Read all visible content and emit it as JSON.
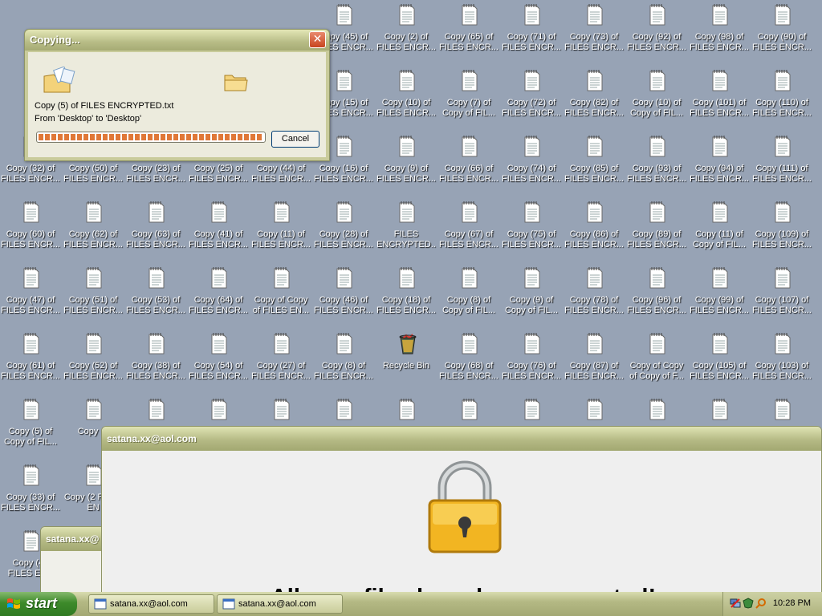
{
  "desktop": {
    "icons": [
      {
        "label": "Copy (45) of FILES ENCR...",
        "type": "text"
      },
      {
        "label": "Copy (2) of FILES ENCR...",
        "type": "text"
      },
      {
        "label": "Copy (65) of FILES ENCR...",
        "type": "text"
      },
      {
        "label": "Copy (71) of FILES ENCR...",
        "type": "text"
      },
      {
        "label": "Copy (73) of FILES ENCR...",
        "type": "text"
      },
      {
        "label": "Copy (92) of FILES ENCR...",
        "type": "text"
      },
      {
        "label": "Copy (98) of FILES ENCR...",
        "type": "text"
      },
      {
        "label": "Copy (90) of FILES ENCR...",
        "type": "text"
      },
      {
        "label": "Copy (15) of FILES ENCR...",
        "type": "text"
      },
      {
        "label": "Copy (10) of FILES ENCR...",
        "type": "text"
      },
      {
        "label": "Copy (7) of Copy of FIL...",
        "type": "text"
      },
      {
        "label": "Copy (72) of FILES ENCR...",
        "type": "text"
      },
      {
        "label": "Copy (82) of FILES ENCR...",
        "type": "text"
      },
      {
        "label": "Copy (10) of Copy of FIL...",
        "type": "text"
      },
      {
        "label": "Copy (101) of FILES ENCR...",
        "type": "text"
      },
      {
        "label": "Copy (110) of FILES ENCR...",
        "type": "text"
      },
      {
        "label": "Copy (32) of FILES ENCR...",
        "type": "text"
      },
      {
        "label": "Copy (50) of FILES ENCR...",
        "type": "text"
      },
      {
        "label": "Copy (23) of FILES ENCR...",
        "type": "text"
      },
      {
        "label": "Copy (25) of FILES ENCR...",
        "type": "text"
      },
      {
        "label": "Copy (44) of FILES ENCR...",
        "type": "text"
      },
      {
        "label": "Copy (16) of FILES ENCR...",
        "type": "text"
      },
      {
        "label": "Copy (9) of FILES ENCR...",
        "type": "text"
      },
      {
        "label": "Copy (66) of FILES ENCR...",
        "type": "text"
      },
      {
        "label": "Copy (74) of FILES ENCR...",
        "type": "text"
      },
      {
        "label": "Copy (85) of FILES ENCR...",
        "type": "text"
      },
      {
        "label": "Copy (93) of FILES ENCR...",
        "type": "text"
      },
      {
        "label": "Copy (94) of FILES ENCR...",
        "type": "text"
      },
      {
        "label": "Copy (111) of FILES ENCR...",
        "type": "text"
      },
      {
        "label": "Copy (60) of FILES ENCR...",
        "type": "text"
      },
      {
        "label": "Copy (62) of FILES ENCR...",
        "type": "text"
      },
      {
        "label": "Copy (63) of FILES ENCR...",
        "type": "text"
      },
      {
        "label": "Copy (41) of FILES ENCR...",
        "type": "text"
      },
      {
        "label": "Copy (11) of FILES ENCR...",
        "type": "text"
      },
      {
        "label": "Copy (28) of FILES ENCR...",
        "type": "text"
      },
      {
        "label": "FILES ENCRYPTED....",
        "type": "text"
      },
      {
        "label": "Copy (67) of FILES ENCR...",
        "type": "text"
      },
      {
        "label": "Copy (75) of FILES ENCR...",
        "type": "text"
      },
      {
        "label": "Copy (86) of FILES ENCR...",
        "type": "text"
      },
      {
        "label": "Copy (89) of FILES ENCR...",
        "type": "text"
      },
      {
        "label": "Copy (11) of Copy of FIL...",
        "type": "text"
      },
      {
        "label": "Copy (109) of FILES ENCR...",
        "type": "text"
      },
      {
        "label": "Copy (47) of FILES ENCR...",
        "type": "text"
      },
      {
        "label": "Copy (51) of FILES ENCR...",
        "type": "text"
      },
      {
        "label": "Copy (53) of FILES ENCR...",
        "type": "text"
      },
      {
        "label": "Copy (64) of FILES ENCR...",
        "type": "text"
      },
      {
        "label": "Copy of Copy of FILES EN...",
        "type": "text"
      },
      {
        "label": "Copy (46) of FILES ENCR...",
        "type": "text"
      },
      {
        "label": "Copy (18) of FILES ENCR...",
        "type": "text"
      },
      {
        "label": "Copy (8) of Copy of FIL...",
        "type": "text"
      },
      {
        "label": "Copy (9) of Copy of FIL...",
        "type": "text"
      },
      {
        "label": "Copy (78) of FILES ENCR...",
        "type": "text"
      },
      {
        "label": "Copy (96) of FILES ENCR...",
        "type": "text"
      },
      {
        "label": "Copy (99) of FILES ENCR...",
        "type": "text"
      },
      {
        "label": "Copy (107) of FILES ENCR...",
        "type": "text"
      },
      {
        "label": "Copy (61) of FILES ENCR...",
        "type": "text"
      },
      {
        "label": "Copy (52) of FILES ENCR...",
        "type": "text"
      },
      {
        "label": "Copy (38) of FILES ENCR...",
        "type": "text"
      },
      {
        "label": "Copy (54) of FILES ENCR...",
        "type": "text"
      },
      {
        "label": "Copy (27) of FILES ENCR...",
        "type": "text"
      },
      {
        "label": "Copy (8) of FILES ENCR...",
        "type": "text"
      },
      {
        "label": "Recycle Bin",
        "type": "recycle"
      },
      {
        "label": "Copy (68) of FILES ENCR...",
        "type": "text"
      },
      {
        "label": "Copy (76) of FILES ENCR...",
        "type": "text"
      },
      {
        "label": "Copy (87) of FILES ENCR...",
        "type": "text"
      },
      {
        "label": "Copy of Copy of Copy of F...",
        "type": "text"
      },
      {
        "label": "Copy (105) of FILES ENCR...",
        "type": "text"
      },
      {
        "label": "Copy (103) of FILES ENCR...",
        "type": "text"
      },
      {
        "label": "Copy (5) of Copy of FIL...",
        "type": "text"
      },
      {
        "label": "Copy (3",
        "type": "text"
      },
      {
        "label": "",
        "type": "text"
      },
      {
        "label": "",
        "type": "text"
      },
      {
        "label": "",
        "type": "text"
      },
      {
        "label": "",
        "type": "text"
      },
      {
        "label": "",
        "type": "text"
      },
      {
        "label": "",
        "type": "text"
      },
      {
        "label": "",
        "type": "text"
      },
      {
        "label": "",
        "type": "text"
      },
      {
        "label": "",
        "type": "text"
      },
      {
        "label": "",
        "type": "text"
      },
      {
        "label": "",
        "type": "text"
      },
      {
        "label": "Copy (33) of FILES ENCR...",
        "type": "text"
      },
      {
        "label": "Copy (2 FILES EN",
        "type": "text"
      },
      {
        "label": "Copy (48 FILES ENC",
        "type": "text"
      }
    ]
  },
  "copy_dialog": {
    "title": "Copying...",
    "close_glyph": "✕",
    "message": "Copy (5) of FILES ENCRYPTED.txt",
    "from_to": "From 'Desktop' to 'Desktop'",
    "progress": 1.0,
    "cancel_label": "Cancel"
  },
  "ransom_window": {
    "title": "satana.xx@aol.com",
    "headline": "All your files have been encrypted!",
    "back_title": "satana.xx@"
  },
  "taskbar": {
    "start_label": "start",
    "tasks": [
      {
        "label": "satana.xx@aol.com"
      },
      {
        "label": "satana.xx@aol.com"
      }
    ],
    "clock": "10:28 PM"
  },
  "colors": {
    "desktop_bg": "#97a3b5",
    "title_olive": "#b5ba85",
    "start_green": "#3d8a2a",
    "close_red": "#c8451f",
    "lock_gold": "#f2b522"
  }
}
